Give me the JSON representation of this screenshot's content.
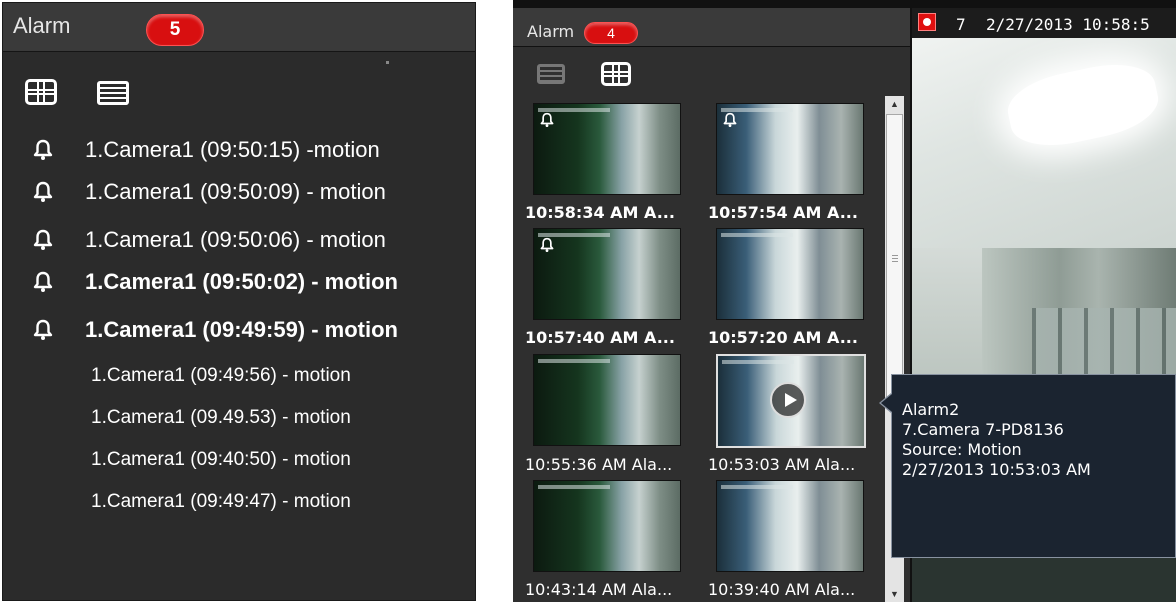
{
  "left_panel": {
    "title": "Alarm",
    "count": "5",
    "view_icons": [
      "grid-icon",
      "list-icon"
    ],
    "items": [
      {
        "text": "1.Camera1  (09:50:15) -motion",
        "icon": "bell-icon"
      },
      {
        "text": "1.Camera1  (09:50:09) - motion",
        "icon": "bell-icon"
      },
      {
        "text": "1.Camera1  (09:50:06) - motion",
        "icon": "bell-icon"
      },
      {
        "text": "1.Camera1  (09:50:02) - motion",
        "icon": "bell-icon"
      },
      {
        "text": "1.Camera1  (09:49:59) - motion",
        "icon": "bell-icon"
      },
      {
        "text": "1.Camera1  (09:49:56)  - motion",
        "icon": ""
      },
      {
        "text": "1.Camera1  (09.49.53)  - motion",
        "icon": ""
      },
      {
        "text": "1.Camera1  (09:40:50)  - motion",
        "icon": ""
      },
      {
        "text": "1.Camera1  (09:49:47)  - motion",
        "icon": ""
      }
    ]
  },
  "right_panel": {
    "title": "Alarm",
    "count": "4",
    "view_icons": [
      "list-icon",
      "grid-icon"
    ],
    "thumbnails": [
      {
        "label": "10:58:34 AM A...",
        "bell": true
      },
      {
        "label": "10:57:54 AM A...",
        "bell": true
      },
      {
        "label": "10:57:40 AM A...",
        "bell": true
      },
      {
        "label": "10:57:20 AM A...",
        "bell": false
      },
      {
        "label": "10:55:36 AM Ala...",
        "bell": false
      },
      {
        "label": "10:53:03 AM Ala...",
        "bell": false
      },
      {
        "label": "10:43:14 AM Ala...",
        "bell": false
      },
      {
        "label": "10:39:40 AM Ala...",
        "bell": false
      }
    ]
  },
  "video": {
    "channel": "7",
    "timestamp": "2/27/2013 10:58:5",
    "record_color": "#e01010"
  },
  "tooltip": {
    "lines": [
      "Alarm2",
      "7.Camera 7-PD8136",
      "Source: Motion",
      "2/27/2013 10:53:03 AM"
    ]
  },
  "colors": {
    "badge": "#d80f10",
    "panel_bg": "#2b2b2b",
    "tooltip_bg": "#1b2430"
  }
}
